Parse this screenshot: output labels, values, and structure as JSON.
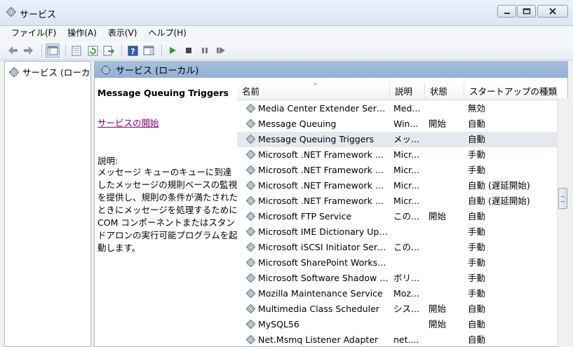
{
  "window": {
    "title": "サービス"
  },
  "menu": [
    "ファイル(F)",
    "操作(A)",
    "表示(V)",
    "ヘルプ(H)"
  ],
  "toolbar": {
    "icons": [
      "back-arrow-icon",
      "forward-arrow-icon",
      "show-hide-tree-icon",
      "properties-icon",
      "refresh-icon",
      "export-list-icon",
      "help-icon",
      "view-icon",
      "start-icon",
      "stop-icon",
      "pause-icon",
      "restart-icon"
    ]
  },
  "tree": {
    "root_label": "サービス (ローカル)"
  },
  "panel": {
    "header": "サービス (ローカル)"
  },
  "details": {
    "service_name": "Message Queuing Triggers",
    "start_link": "サービスの開始",
    "desc_label": "説明:",
    "desc_text": "メッセージ キューのキューに到達したメッセージの規則ベースの監視を提供し、規則の条件が満たされたときにメッセージを処理するためにCOM コンポーネントまたはスタンドアロンの実行可能プログラムを起動します。"
  },
  "table": {
    "columns": [
      "名前",
      "説明",
      "状態",
      "スタートアップの種類"
    ],
    "sort_arrow": "^",
    "rows": [
      {
        "name": "Media Center Extender Service",
        "desc": "Med...",
        "status": "",
        "startup": "無効"
      },
      {
        "name": "Message Queuing",
        "desc": "Win...",
        "status": "開始",
        "startup": "自動"
      },
      {
        "name": "Message Queuing Triggers",
        "desc": "メッ...",
        "status": "",
        "startup": "自動",
        "selected": true
      },
      {
        "name": "Microsoft .NET Framework N...",
        "desc": "Micr...",
        "status": "",
        "startup": "手動"
      },
      {
        "name": "Microsoft .NET Framework N...",
        "desc": "Micr...",
        "status": "",
        "startup": "手動"
      },
      {
        "name": "Microsoft .NET Framework N...",
        "desc": "Micr...",
        "status": "",
        "startup": "自動 (遅延開始)"
      },
      {
        "name": "Microsoft .NET Framework N...",
        "desc": "Micr...",
        "status": "",
        "startup": "自動 (遅延開始)"
      },
      {
        "name": "Microsoft FTP Service",
        "desc": "この...",
        "status": "開始",
        "startup": "自動"
      },
      {
        "name": "Microsoft IME Dictionary Upd...",
        "desc": "",
        "status": "",
        "startup": "手動"
      },
      {
        "name": "Microsoft iSCSI Initiator Serv...",
        "desc": "この...",
        "status": "",
        "startup": "手動"
      },
      {
        "name": "Microsoft SharePoint Worksp...",
        "desc": "",
        "status": "",
        "startup": "手動"
      },
      {
        "name": "Microsoft Software Shadow C...",
        "desc": "ボリ...",
        "status": "",
        "startup": "手動"
      },
      {
        "name": "Mozilla Maintenance Service",
        "desc": "Moz...",
        "status": "",
        "startup": "手動"
      },
      {
        "name": "Multimedia Class Scheduler",
        "desc": "シス...",
        "status": "開始",
        "startup": "自動"
      },
      {
        "name": "MySQL56",
        "desc": "",
        "status": "開始",
        "startup": "自動"
      },
      {
        "name": "Net.Msmq Listener Adapter",
        "desc": "net....",
        "status": "",
        "startup": "自動"
      }
    ]
  },
  "colors": {
    "header_bar": "#99b4d6",
    "link_visited": "#800080",
    "selected_row": "#e5e9ee"
  }
}
